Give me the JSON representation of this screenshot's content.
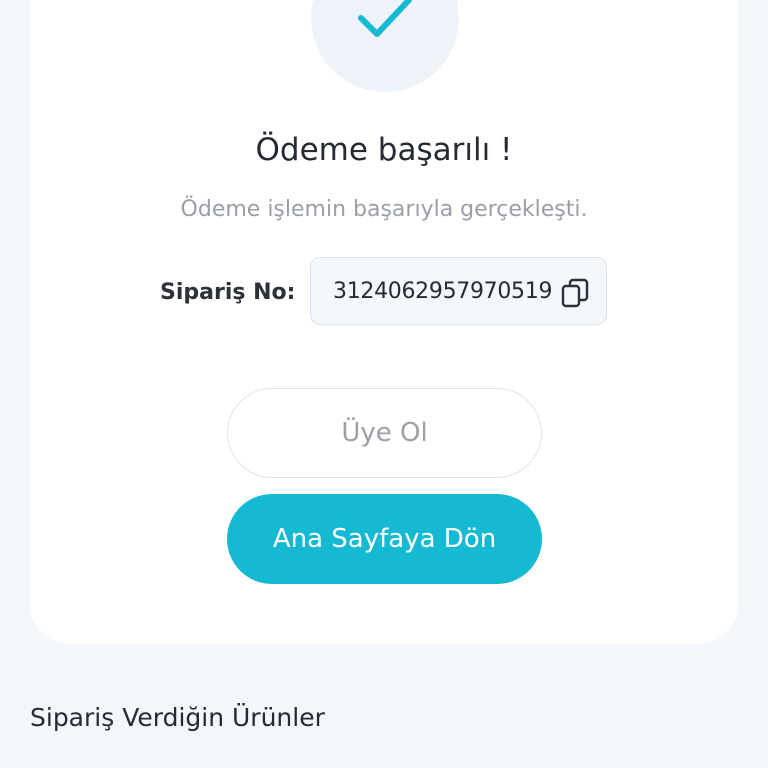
{
  "success": {
    "title": "Ödeme başarılı !",
    "subtitle": "Ödeme işlemin başarıyla gerçekleşti."
  },
  "order": {
    "label": "Sipariş No:",
    "number": "3124062957970519"
  },
  "buttons": {
    "signup_label": "Üye Ol",
    "home_label": "Ana Sayfaya Dön"
  },
  "products_section": {
    "title": "Sipariş Verdiğin Ürünler"
  },
  "colors": {
    "accent": "#16b9d2",
    "background": "#f3f6fb",
    "card": "#ffffff"
  },
  "icons": {
    "success": "check-icon",
    "copy": "copy-icon"
  }
}
